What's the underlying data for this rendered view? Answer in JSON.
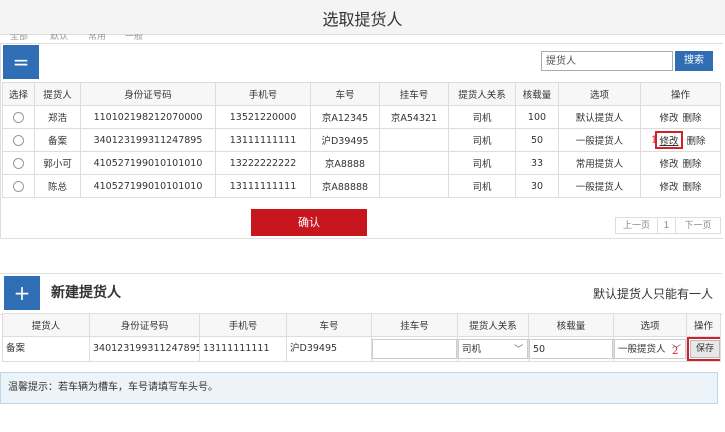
{
  "page_title": "选取提货人",
  "filter_fragments": [
    "全部",
    "默认",
    "常用",
    "一般"
  ],
  "panel1": {
    "collapse_icon": "=",
    "search_placeholder": "提货人",
    "search_button": "搜索"
  },
  "table1": {
    "headers": [
      "选择",
      "提货人",
      "身份证号码",
      "手机号",
      "车号",
      "挂车号",
      "提货人关系",
      "核载量",
      "选项",
      "操作"
    ],
    "rows": [
      {
        "name": "郑浩",
        "id": "110102198212070000",
        "phone": "13521220000",
        "car": "京A12345",
        "trailer": "京A54321",
        "relation": "司机",
        "load": "100",
        "option": "默认提货人",
        "edit": "修改",
        "del": "删除"
      },
      {
        "name": "备案",
        "id": "340123199311247895",
        "phone": "13111111111",
        "car": "沪D39495",
        "trailer": "",
        "relation": "司机",
        "load": "50",
        "option": "一般提货人",
        "edit": "修改",
        "del": "删除"
      },
      {
        "name": "郭小可",
        "id": "410527199010101010",
        "phone": "13222222222",
        "car": "京A8888",
        "trailer": "",
        "relation": "司机",
        "load": "33",
        "option": "常用提货人",
        "edit": "修改",
        "del": "删除"
      },
      {
        "name": "陈总",
        "id": "410527199010101010",
        "phone": "13111111111",
        "car": "京A88888",
        "trailer": "",
        "relation": "司机",
        "load": "30",
        "option": "一般提货人",
        "edit": "修改",
        "del": "删除"
      }
    ]
  },
  "annotation_1": "1",
  "annotation_2": "2",
  "confirm_button": "确认",
  "pagination": {
    "prev": "上一页",
    "page": "1",
    "next": "下一页"
  },
  "panel2": {
    "add_icon": "+",
    "title": "新建提货人",
    "notice": "默认提货人只能有一人"
  },
  "table2": {
    "headers": [
      "提货人",
      "身份证号码",
      "手机号",
      "车号",
      "挂车号",
      "提货人关系",
      "核载量",
      "选项",
      "操作"
    ],
    "row": {
      "name": "备案",
      "id": "340123199311247895",
      "phone": "13111111111",
      "car": "沪D39495",
      "trailer": "",
      "relation": "司机",
      "load": "50",
      "option": "一般提货人",
      "save": "保存"
    }
  },
  "tip": "温馨提示：若车辆为槽车，车号请填写车头号。",
  "colors": {
    "accent": "#2f6db4",
    "confirm": "#c8161e",
    "highlight": "#d0202a"
  }
}
